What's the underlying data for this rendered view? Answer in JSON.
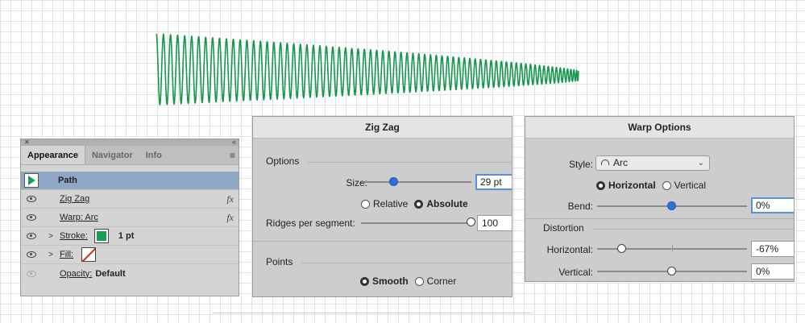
{
  "canvas": {
    "stroke_color": "#15964f"
  },
  "appearance_panel": {
    "tabs": [
      "Appearance",
      "Navigator",
      "Info"
    ],
    "active_tab": "Appearance",
    "rows": {
      "path": {
        "label": "Path"
      },
      "zigzag": {
        "label": "Zig Zag",
        "fx": "fx"
      },
      "warp": {
        "label": "Warp: Arc",
        "fx": "fx"
      },
      "stroke": {
        "label": "Stroke:",
        "value": "1 pt",
        "color": "#1a9e55"
      },
      "fill": {
        "label": "Fill:",
        "value": "none"
      },
      "opacity": {
        "label": "Opacity:",
        "value": "Default"
      }
    }
  },
  "zigzag_dialog": {
    "title": "Zig Zag",
    "options_label": "Options",
    "size": {
      "label": "Size:",
      "value": "29 pt",
      "slider_fraction": 0.3
    },
    "mode": {
      "relative": "Relative",
      "absolute": "Absolute",
      "selected": "Absolute"
    },
    "ridges": {
      "label": "Ridges per segment:",
      "value": "100",
      "slider_fraction": 1.0
    },
    "points_label": "Points",
    "points": {
      "smooth": "Smooth",
      "corner": "Corner",
      "selected": "Smooth"
    }
  },
  "warp_dialog": {
    "title": "Warp Options",
    "style": {
      "label": "Style:",
      "value": "Arc"
    },
    "orientation": {
      "horizontal": "Horizontal",
      "vertical": "Vertical",
      "selected": "Horizontal"
    },
    "bend": {
      "label": "Bend:",
      "value": "0%",
      "slider_fraction": 0.5
    },
    "distortion_label": "Distortion",
    "horizontal": {
      "label": "Horizontal:",
      "value": "-67%",
      "slider_fraction": 0.165
    },
    "vertical": {
      "label": "Vertical:",
      "value": "0%",
      "slider_fraction": 0.5
    }
  }
}
